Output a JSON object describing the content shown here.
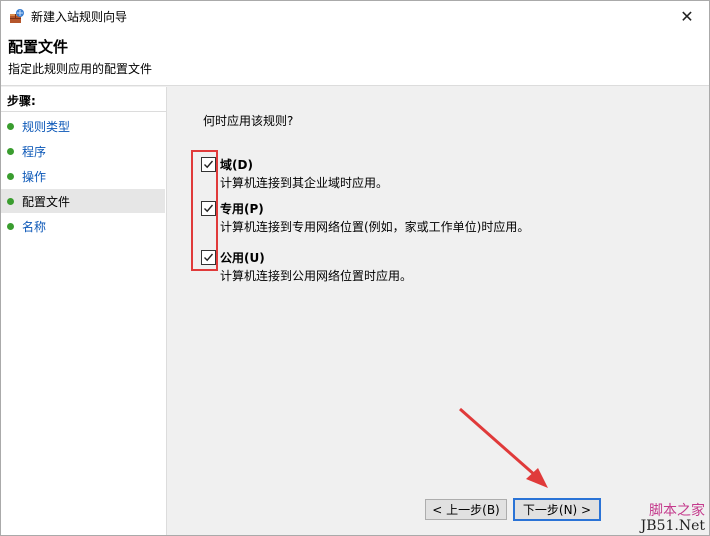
{
  "window": {
    "title": "新建入站规则向导",
    "close_glyph": "✕"
  },
  "header": {
    "title": "配置文件",
    "subtitle": "指定此规则应用的配置文件"
  },
  "sidebar": {
    "steps_title": "步骤:",
    "items": [
      {
        "label": "规则类型",
        "active": false
      },
      {
        "label": "程序",
        "active": false
      },
      {
        "label": "操作",
        "active": false
      },
      {
        "label": "配置文件",
        "active": true
      },
      {
        "label": "名称",
        "active": false
      }
    ]
  },
  "main": {
    "question": "何时应用该规则?",
    "options": [
      {
        "label": "域(D)",
        "description": "计算机连接到其企业域时应用。",
        "checked": true
      },
      {
        "label": "专用(P)",
        "description": "计算机连接到专用网络位置(例如，家或工作单位)时应用。",
        "checked": true
      },
      {
        "label": "公用(U)",
        "description": "计算机连接到公用网络位置时应用。",
        "checked": true
      }
    ]
  },
  "buttons": {
    "back": "< 上一步(B)",
    "next": "下一步(N) >"
  },
  "watermark": {
    "top": "脚本之家",
    "bottom": "JB51.Net"
  },
  "colors": {
    "highlight": "#e03a3a",
    "step_dot": "#3a9d2f",
    "link": "#0b57b7"
  }
}
